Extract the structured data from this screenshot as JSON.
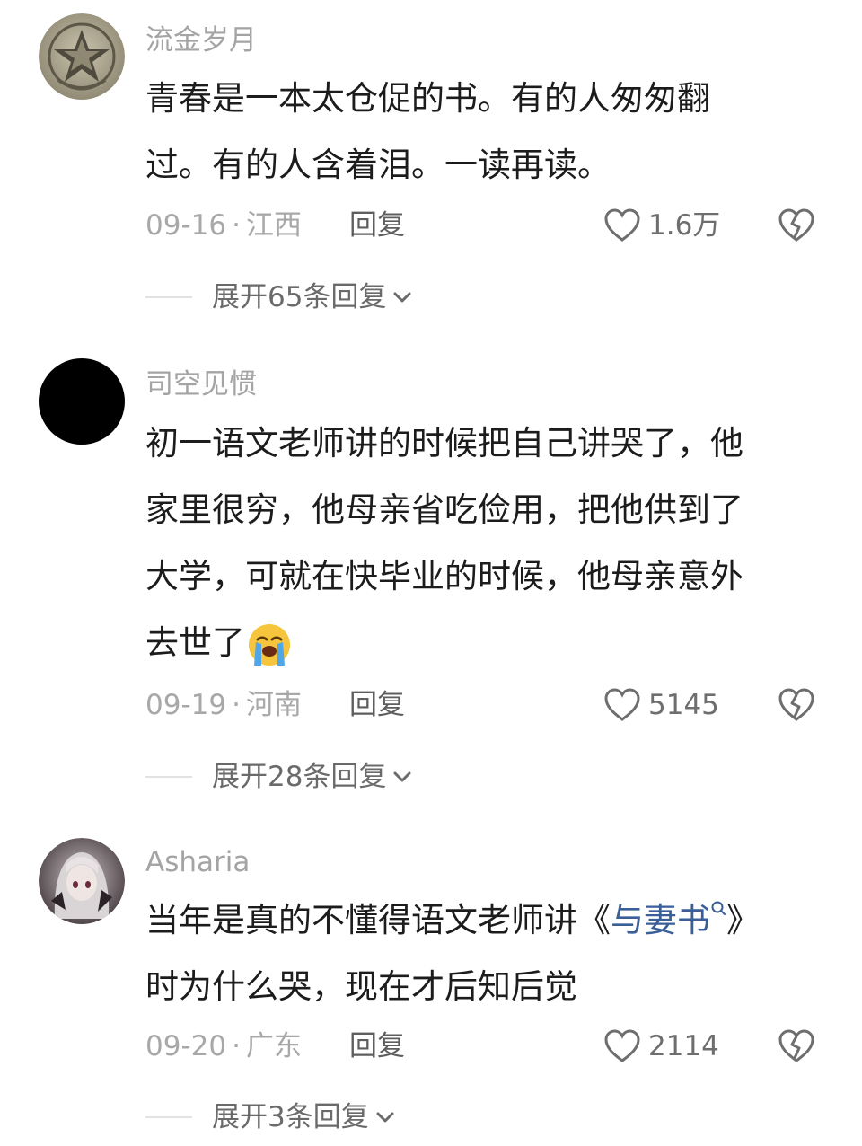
{
  "comments": [
    {
      "username": "流金岁月",
      "lines": [
        "青春是一本太仓促的书。有的人匆匆翻",
        "过。有的人含着泪。一读再读。"
      ],
      "date": "09-16",
      "separator": "·",
      "location": "江西",
      "reply_label": "回复",
      "likes": "1.6万",
      "expand_label": "展开65条回复",
      "avatar_icon": "military-badge-avatar"
    },
    {
      "username": "司空见惯",
      "lines": [
        "初一语文老师讲的时候把自己讲哭了，他",
        "家里很穷，他母亲省吃俭用，把他供到了",
        "大学，可就在快毕业的时候，他母亲意外",
        "去世了"
      ],
      "emoji": "loudly-crying-face",
      "date": "09-19",
      "separator": "·",
      "location": "河南",
      "reply_label": "回复",
      "likes": "5145",
      "expand_label": "展开28条回复",
      "avatar_icon": "black-circle-avatar"
    },
    {
      "username": "Asharia",
      "line1_before": "当年是真的不懂得语文老师讲《",
      "link": "与妻书",
      "line1_after": "》",
      "line2": "时为什么哭，现在才后知后觉",
      "date": "09-20",
      "separator": "·",
      "location": "广东",
      "reply_label": "回复",
      "likes": "2114",
      "expand_label": "展开3条回复",
      "avatar_icon": "anime-girl-avatar"
    }
  ],
  "icons": {
    "like": "heart-outline-icon",
    "dislike": "broken-heart-icon",
    "expand": "chevron-down-icon",
    "search": "search-icon"
  },
  "colors": {
    "text": "#1c1c1c",
    "meta": "#a8a8a8",
    "link": "#3a5e98",
    "icon": "#6e6e6e"
  }
}
